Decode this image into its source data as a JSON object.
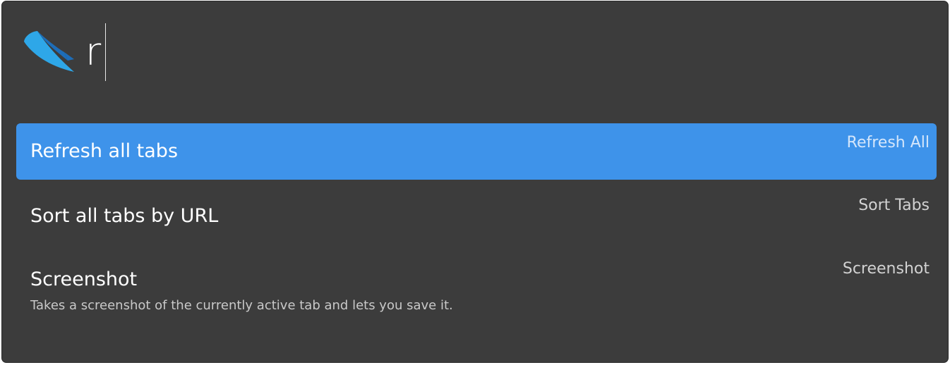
{
  "search": {
    "query": "r",
    "logo_icon": "feather-logo-icon"
  },
  "colors": {
    "panel_background": "#3c3c3c",
    "selected_background": "#3e93ea",
    "logo_light": "#2ea7e8",
    "logo_dark": "#1d6db8"
  },
  "results": [
    {
      "title": "Refresh all tabs",
      "description": "",
      "shortcut": "Refresh All",
      "selected": true
    },
    {
      "title": "Sort all tabs by URL",
      "description": "",
      "shortcut": "Sort Tabs",
      "selected": false
    },
    {
      "title": "Screenshot",
      "description": "Takes a screenshot of the currently active tab and lets you save it.",
      "shortcut": "Screenshot",
      "selected": false
    }
  ]
}
